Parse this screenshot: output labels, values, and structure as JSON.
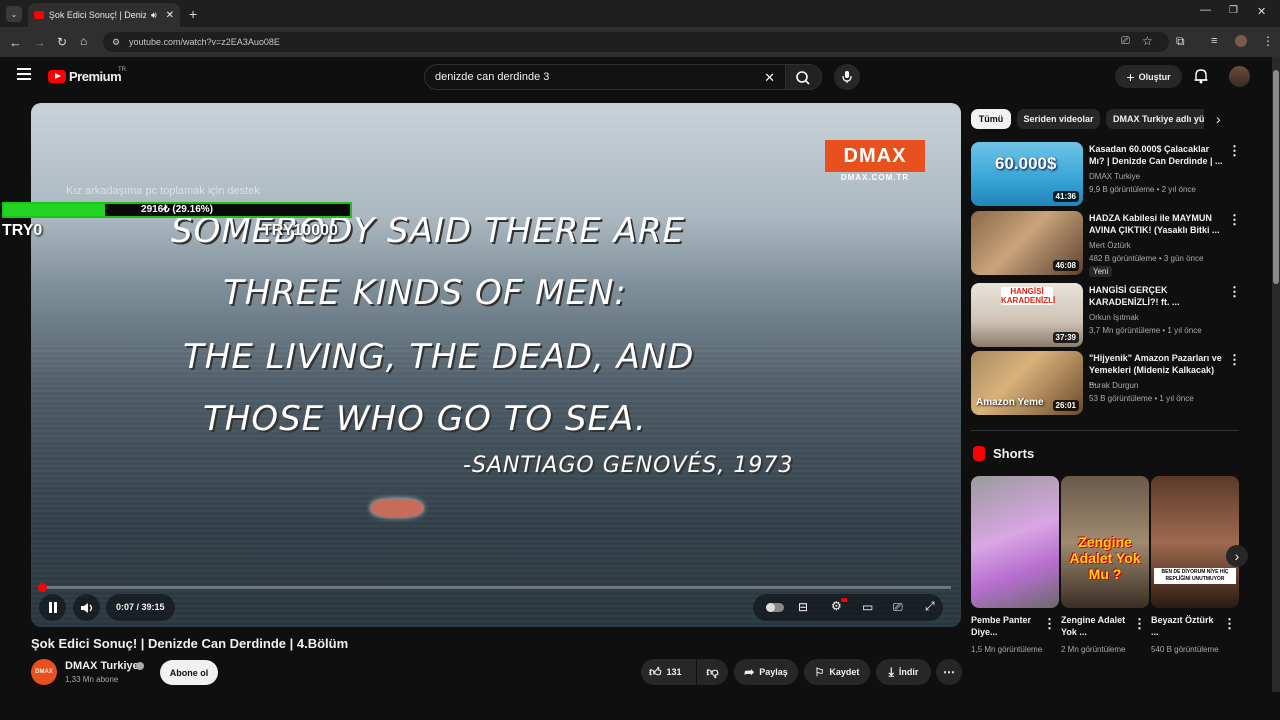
{
  "browser": {
    "tab_title": "Şok Edici Sonuç! | Denizde C",
    "url": "youtube.com/watch?v=z2EA3Auo08E"
  },
  "header": {
    "logo_text": "Premium",
    "region": "TR",
    "search_value": "denizde can derdinde 3",
    "create_label": "Oluştur"
  },
  "video": {
    "quote_lines": [
      "SOMEBODY SAID THERE ARE",
      "THREE KINDS OF MEN:",
      "THE LIVING, THE DEAD, AND",
      "THOSE WHO GO TO SEA."
    ],
    "quote_author": "-SANTIAGO GENOVÉS, 1973",
    "channel_logo": "DMAX",
    "channel_site": "DMAX.COM.TR",
    "time": "0:07 / 39:15",
    "played_fraction": 0.003
  },
  "donation": {
    "title": "Kız arkadaşıma pc toplamak için destek",
    "progress_text": "2916₺ (29.16%)",
    "progress_fraction": 0.2916,
    "min_label": "TRY0",
    "max_label": "TRY10000"
  },
  "info": {
    "title": "Şok Edici Sonuç! | Denizde Can Derdinde | 4.Bölüm",
    "channel": "DMAX Turkiye",
    "subscribers": "1,33 Mn abone",
    "avatar_text": "DMAX",
    "subscribe_label": "Abone ol",
    "likes": "131",
    "share_label": "Paylaş",
    "save_label": "Kaydet",
    "download_label": "İndir"
  },
  "chips": [
    "Tümü",
    "Seriden videolar",
    "DMAX Turkiye adlı yü"
  ],
  "related": [
    {
      "title": "Kasadan 60.000$ Çalacaklar Mı? | Denizde Can Derdinde | ...",
      "channel": "DMAX Turkiye",
      "views": "9,9 B görüntüleme • 2 yıl önce",
      "duration": "41:36",
      "thumb_text": "60.000$",
      "badge": ""
    },
    {
      "title": "HADZA Kabilesi ile MAYMUN AVINA ÇIKTIK! (Yasaklı Bitki ...",
      "channel": "Mert Öztürk",
      "views": "482 B görüntüleme • 3 gün önce",
      "duration": "46:08",
      "thumb_text": "",
      "badge": "Yeni"
    },
    {
      "title": "HANGİSİ GERÇEK KARADENİZLİ?! ft. ...",
      "channel": "Orkun Işıtmak",
      "views": "3,7 Mn görüntüleme • 1 yıl önce",
      "duration": "37:39",
      "thumb_text": "HANGİSİ KARADENİZLİ",
      "badge": ""
    },
    {
      "title": "\"Hijyenik\" Amazon Pazarları ve Yemekleri (Mideniz Kalkacak) ...",
      "channel": "Burak Durgun",
      "views": "53 B görüntüleme • 1 yıl önce",
      "duration": "26:01",
      "thumb_text": "Amazon Yeme",
      "badge": ""
    }
  ],
  "shorts": {
    "heading": "Shorts",
    "items": [
      {
        "title": "Pembe Panter Diye...",
        "views": "1,5 Mn görüntüleme",
        "thumb_text": ""
      },
      {
        "title": "Zengine Adalet Yok ...",
        "views": "2 Mn görüntüleme",
        "thumb_text": "Zengine Adalet Yok Mu ?"
      },
      {
        "title": "Beyazıt Öztürk ...",
        "views": "540 B görüntüleme",
        "thumb_text": "BEN DE DİYORUM NİYE HİÇ REPLİĞİNİ UNUTMUYOR"
      }
    ]
  },
  "colors": {
    "accent": "#ff0000",
    "donation_green": "#23d423",
    "dmax_orange": "#e8501d"
  }
}
